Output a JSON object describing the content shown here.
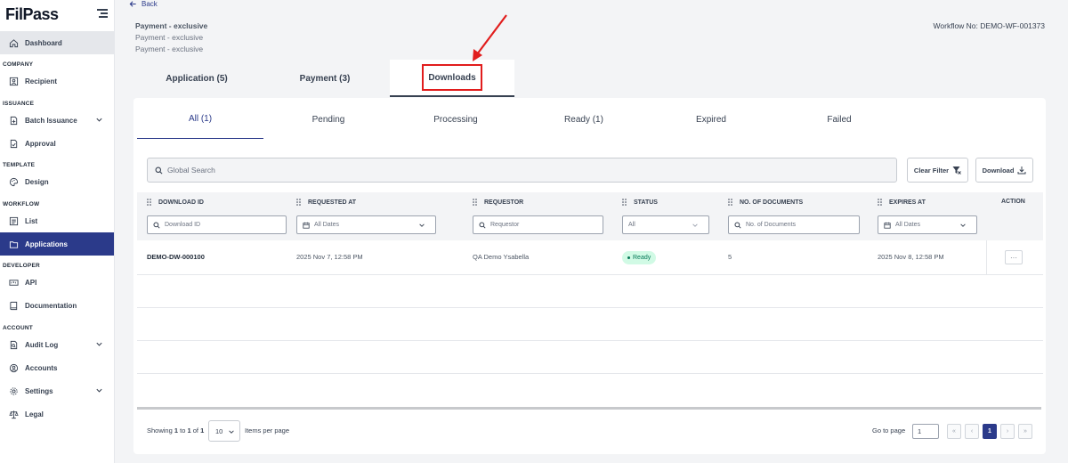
{
  "app": {
    "logo": "FilPass",
    "brand_color": "#2b3a8a",
    "accent_red": "#e11d1d"
  },
  "sidebar": {
    "sections": {
      "company": "COMPANY",
      "issuance": "ISSUANCE",
      "template": "TEMPLATE",
      "workflow": "WORKFLOW",
      "developer": "DEVELOPER",
      "account": "ACCOUNT"
    },
    "items": {
      "dashboard": "Dashboard",
      "recipient": "Recipient",
      "batch_issuance": "Batch Issuance",
      "approval": "Approval",
      "design": "Design",
      "list": "List",
      "applications": "Applications",
      "api": "API",
      "documentation": "Documentation",
      "audit_log": "Audit Log",
      "accounts": "Accounts",
      "settings": "Settings",
      "legal": "Legal"
    }
  },
  "header": {
    "back": "Back",
    "title": "Payment - exclusive",
    "subtitle1": "Payment - exclusive",
    "subtitle2": "Payment - exclusive",
    "workflow_no": "Workflow No: DEMO-WF-001373"
  },
  "main_tabs": [
    "Application (5)",
    "Payment (3)",
    "Downloads"
  ],
  "active_main_tab": "Downloads",
  "sub_tabs": [
    "All (1)",
    "Pending",
    "Processing",
    "Ready (1)",
    "Expired",
    "Failed"
  ],
  "active_sub_tab": "All (1)",
  "toolbar": {
    "search_placeholder": "Global Search",
    "clear_filter": "Clear Filter",
    "download": "Download"
  },
  "table": {
    "columns": [
      "DOWNLOAD ID",
      "REQUESTED AT",
      "REQUESTOR",
      "STATUS",
      "NO. OF DOCUMENTS",
      "EXPIRES AT",
      "ACTION"
    ],
    "filters": {
      "download_id": "Download ID",
      "requested_at": "All Dates",
      "requestor": "Requestor",
      "status": "All",
      "no_of_documents": "No. of Documents",
      "expires_at": "All Dates"
    },
    "rows": [
      {
        "download_id": "DEMO-DW-000100",
        "requested_at": "2025 Nov 7, 12:58 PM",
        "requestor": "QA Demo Ysabella",
        "status": "Ready",
        "no_of_documents": "5",
        "expires_at": "2025 Nov 8, 12:58 PM",
        "action": "···"
      }
    ]
  },
  "footer": {
    "showing_prefix": "Showing",
    "from": "1",
    "to_word": "to",
    "to": "1",
    "of_word": "of",
    "total": "1",
    "per_page": "10",
    "items_per_page": "Items per page",
    "go_to_page": "Go to page",
    "page_input": "1",
    "first": "«",
    "prev": "‹",
    "current_page": "1",
    "next": "›",
    "last": "»"
  }
}
